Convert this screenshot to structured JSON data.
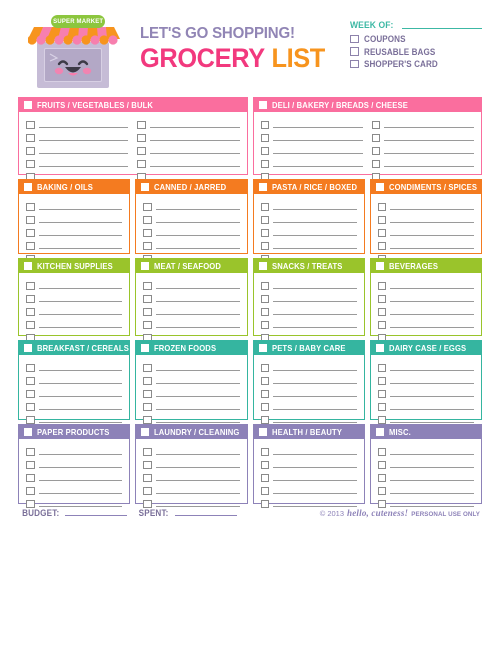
{
  "logo": {
    "sign_text": "SUPER MARKET",
    "icon_name": "supermarket-store-icon",
    "colors": {
      "sign": "#8cc63e",
      "awning_orange": "#f7941e",
      "awning_pink": "#f striped",
      "building": "#c6bcd6"
    }
  },
  "header": {
    "title_line1": "LET'S GO SHOPPING!",
    "title_grocery": "GROCERY",
    "title_list": "LIST",
    "week_of_label": "WEEK OF:",
    "week_of_value": "",
    "options": [
      {
        "label": "COUPONS",
        "checked": false
      },
      {
        "label": "REUSABLE BAGS",
        "checked": false
      },
      {
        "label": "SHOPPER'S CARD",
        "checked": false
      }
    ]
  },
  "colors": {
    "pink": "#fa6e9e",
    "orange": "#f47b20",
    "green": "#9ac42b",
    "teal": "#35b5a0",
    "purple": "#8d82b8",
    "title_purple": "#9185b5",
    "title_pink": "#f2397e",
    "title_orange": "#f7941e",
    "teal_accent": "#3cb8a4"
  },
  "rows": [
    {
      "color": "pink",
      "sections": [
        {
          "title": "FRUITS / VEGETABLES / BULK",
          "columns": 2,
          "rows": 5,
          "items": [
            "",
            "",
            "",
            "",
            "",
            "",
            "",
            "",
            "",
            ""
          ]
        },
        {
          "title": "DELI / BAKERY / BREADS / CHEESE",
          "columns": 2,
          "rows": 5,
          "items": [
            "",
            "",
            "",
            "",
            "",
            "",
            "",
            "",
            "",
            ""
          ]
        }
      ]
    },
    {
      "color": "orange",
      "sections": [
        {
          "title": "BAKING / OILS",
          "columns": 1,
          "rows": 5,
          "items": [
            "",
            "",
            "",
            "",
            ""
          ]
        },
        {
          "title": "CANNED / JARRED",
          "columns": 1,
          "rows": 5,
          "items": [
            "",
            "",
            "",
            "",
            ""
          ]
        },
        {
          "title": "PASTA / RICE / BOXED",
          "columns": 1,
          "rows": 5,
          "items": [
            "",
            "",
            "",
            "",
            ""
          ]
        },
        {
          "title": "CONDIMENTS / SPICES",
          "columns": 1,
          "rows": 5,
          "items": [
            "",
            "",
            "",
            "",
            ""
          ]
        }
      ]
    },
    {
      "color": "green",
      "sections": [
        {
          "title": "KITCHEN SUPPLIES",
          "columns": 1,
          "rows": 5,
          "items": [
            "",
            "",
            "",
            "",
            ""
          ]
        },
        {
          "title": "MEAT / SEAFOOD",
          "columns": 1,
          "rows": 5,
          "items": [
            "",
            "",
            "",
            "",
            ""
          ]
        },
        {
          "title": "SNACKS / TREATS",
          "columns": 1,
          "rows": 5,
          "items": [
            "",
            "",
            "",
            "",
            ""
          ]
        },
        {
          "title": "BEVERAGES",
          "columns": 1,
          "rows": 5,
          "items": [
            "",
            "",
            "",
            "",
            ""
          ]
        }
      ]
    },
    {
      "color": "teal",
      "sections": [
        {
          "title": "BREAKFAST / CEREALS",
          "columns": 1,
          "rows": 5,
          "items": [
            "",
            "",
            "",
            "",
            ""
          ]
        },
        {
          "title": "FROZEN FOODS",
          "columns": 1,
          "rows": 5,
          "items": [
            "",
            "",
            "",
            "",
            ""
          ]
        },
        {
          "title": "PETS / BABY CARE",
          "columns": 1,
          "rows": 5,
          "items": [
            "",
            "",
            "",
            "",
            ""
          ]
        },
        {
          "title": "DAIRY CASE / EGGS",
          "columns": 1,
          "rows": 5,
          "items": [
            "",
            "",
            "",
            "",
            ""
          ]
        }
      ]
    },
    {
      "color": "purple",
      "sections": [
        {
          "title": "PAPER PRODUCTS",
          "columns": 1,
          "rows": 5,
          "items": [
            "",
            "",
            "",
            "",
            ""
          ]
        },
        {
          "title": "LAUNDRY / CLEANING",
          "columns": 1,
          "rows": 5,
          "items": [
            "",
            "",
            "",
            "",
            ""
          ]
        },
        {
          "title": "HEALTH / BEAUTY",
          "columns": 1,
          "rows": 5,
          "items": [
            "",
            "",
            "",
            "",
            ""
          ]
        },
        {
          "title": "MISC.",
          "columns": 1,
          "rows": 5,
          "items": [
            "",
            "",
            "",
            "",
            ""
          ]
        }
      ]
    }
  ],
  "footer": {
    "budget_label": "BUDGET:",
    "budget_value": "",
    "spent_label": "SPENT:",
    "spent_value": "",
    "copyright": "© 2013",
    "brand": "hello, cuteness!",
    "usage_note": "PERSONAL USE ONLY"
  }
}
